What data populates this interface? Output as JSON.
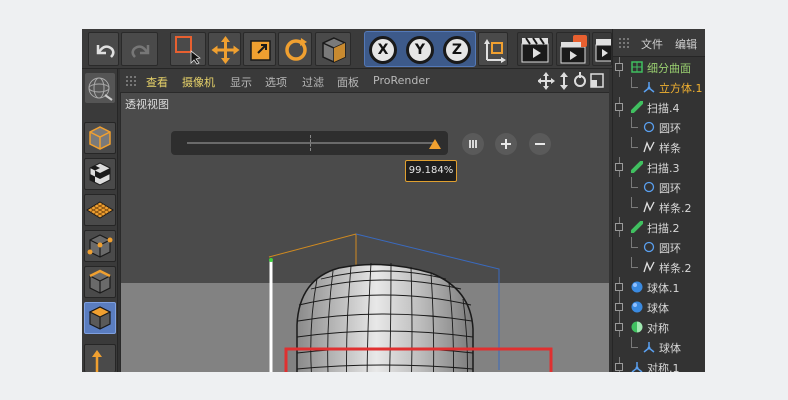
{
  "viewport_menu": {
    "items": [
      "查看",
      "摄像机",
      "显示",
      "选项",
      "过滤",
      "面板",
      "ProRender"
    ]
  },
  "viewport": {
    "title": "透视视图",
    "tooltip_value": "99.184%",
    "slider_fraction": 0.99184
  },
  "axes": [
    "X",
    "Y",
    "Z"
  ],
  "object_manager": {
    "tabs": [
      "文件",
      "编辑"
    ],
    "tree": [
      {
        "label": "细分曲面",
        "level": 0,
        "icon": "subdivision-icon",
        "state": "active"
      },
      {
        "label": "立方体.1",
        "level": 1,
        "icon": "cube-object-icon",
        "state": "selected"
      },
      {
        "label": "扫描.4",
        "level": 0,
        "icon": "sweep-icon"
      },
      {
        "label": "圆环",
        "level": 1,
        "icon": "circle-spline-icon"
      },
      {
        "label": "样条",
        "level": 1,
        "icon": "spline-icon"
      },
      {
        "label": "扫描.3",
        "level": 0,
        "icon": "sweep-icon"
      },
      {
        "label": "圆环",
        "level": 1,
        "icon": "circle-spline-icon"
      },
      {
        "label": "样条.2",
        "level": 1,
        "icon": "spline-icon"
      },
      {
        "label": "扫描.2",
        "level": 0,
        "icon": "sweep-icon"
      },
      {
        "label": "圆环",
        "level": 1,
        "icon": "circle-spline-icon"
      },
      {
        "label": "样条.2",
        "level": 1,
        "icon": "spline-icon"
      },
      {
        "label": "球体.1",
        "level": 0,
        "icon": "sphere-icon"
      },
      {
        "label": "球体",
        "level": 0,
        "icon": "sphere-icon"
      },
      {
        "label": "对称",
        "level": 0,
        "icon": "symmetry-icon"
      },
      {
        "label": "球体",
        "level": 1,
        "icon": "cube-object-icon"
      },
      {
        "label": "对称.1",
        "level": 0,
        "icon": "cube-object-icon"
      }
    ]
  },
  "colors": {
    "accent_orange": "#f0a030",
    "selection_yellow": "#e8d36a",
    "highlight_red": "#e03030",
    "axes_blue": "#3d5a8a"
  }
}
